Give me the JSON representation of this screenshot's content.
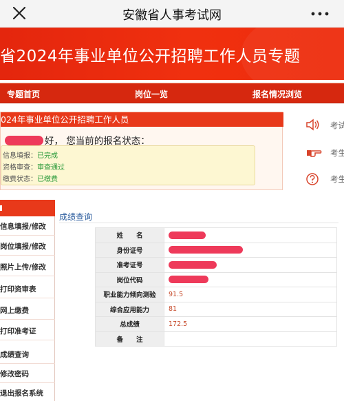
{
  "browser": {
    "title": "安徽省人事考试网",
    "close_icon": "close-icon",
    "more_icon": "more-icon"
  },
  "banner": {
    "title": "省2024年事业单位公开招聘工作人员专题"
  },
  "nav": {
    "items": [
      "专题首页",
      "岗位一览",
      "报名情况浏览"
    ]
  },
  "status_panel": {
    "header": "024年事业单位公开招聘工作人员",
    "greeting_suffix": "好，  您当前的报名状态：",
    "rows": [
      {
        "label": "信息填报：",
        "value": "已完成"
      },
      {
        "label": "资格审查：",
        "value": "审查通过"
      },
      {
        "label": "缴费状态：",
        "value": "已缴费"
      }
    ]
  },
  "side_links": {
    "items": [
      {
        "icon": "speaker-icon",
        "label": "考试"
      },
      {
        "icon": "pointing-hand-icon",
        "label": "考生"
      },
      {
        "icon": "question-icon",
        "label": "考生"
      }
    ]
  },
  "left_menu": {
    "items": [
      "信息填报/修改",
      "岗位填报/修改",
      "照片上传/修改",
      "打印资审表",
      "网上缴费",
      "打印准考证",
      "成绩查询",
      "修改密码",
      "退出报名系统"
    ]
  },
  "results": {
    "section_title": "成绩查询",
    "rows": [
      {
        "label": "姓　　名",
        "value": ""
      },
      {
        "label": "身份证号",
        "value": ""
      },
      {
        "label": "准考证号",
        "value": ""
      },
      {
        "label": "岗位代码",
        "value": ""
      },
      {
        "label": "职业能力倾向测验",
        "value": "91.5"
      },
      {
        "label": "综合应用能力",
        "value": "81"
      },
      {
        "label": "总成绩",
        "value": "172.5"
      },
      {
        "label": "备　　注",
        "value": ""
      }
    ]
  },
  "colors": {
    "brand_red": "#e8391a",
    "status_green": "#2a9a3a",
    "link_blue": "#2c5d9e",
    "redaction": "#ee3a5a"
  }
}
